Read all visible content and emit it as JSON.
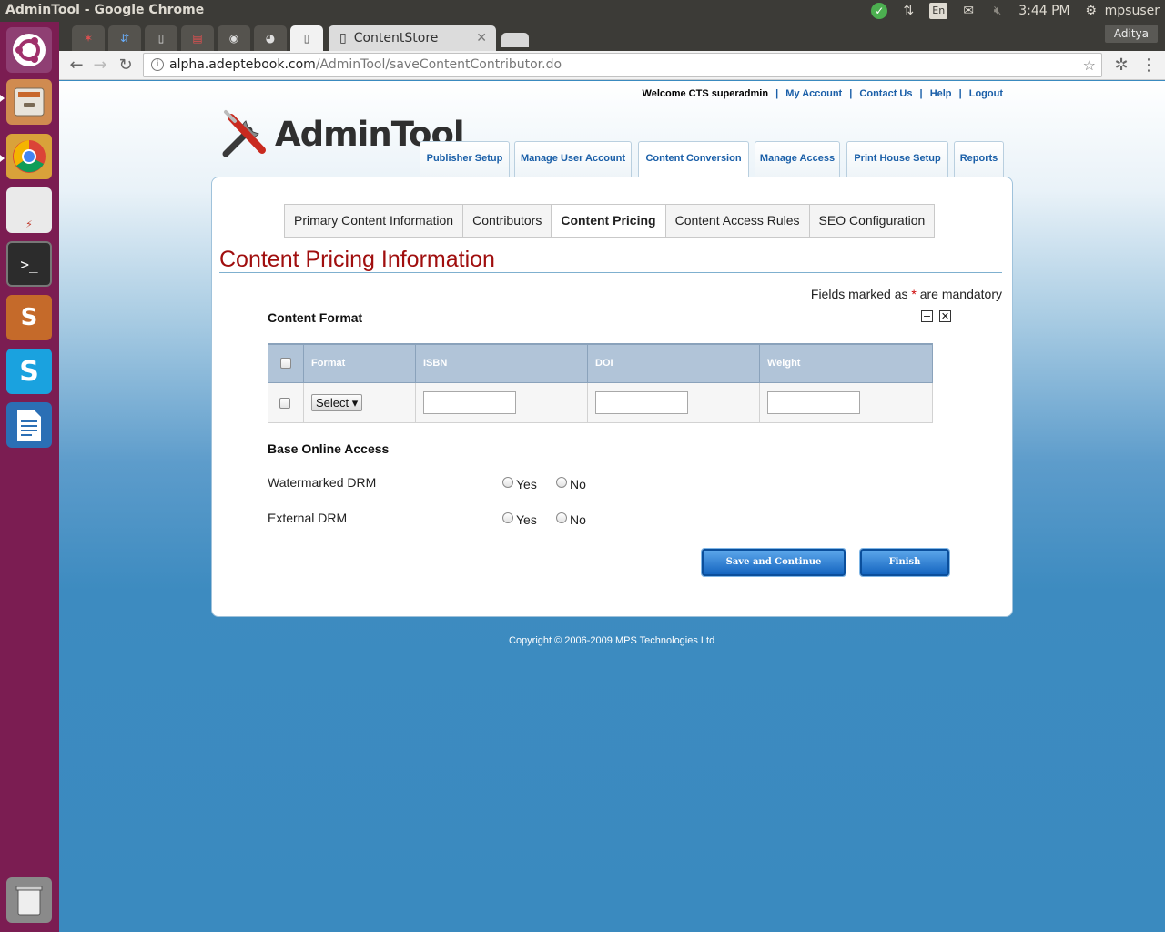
{
  "window": {
    "title": "AdminTool - Google Chrome"
  },
  "tray": {
    "lang": "En",
    "time": "3:44 PM",
    "user": "mpsuser"
  },
  "browser": {
    "active_tab_title": "ContentStore",
    "profile": "Aditya",
    "url_host": "alpha.adeptebook.com",
    "url_path": "/AdminTool/saveContentContributor.do"
  },
  "header": {
    "welcome": "Welcome  CTS superadmin",
    "links": {
      "account": "My Account",
      "contact": "Contact Us",
      "help": "Help",
      "logout": "Logout"
    },
    "logo_text": "AdminTool"
  },
  "main_tabs": [
    "Publisher Setup",
    "Manage User Account",
    "Content Conversion",
    "Manage Access",
    "Print House Setup",
    "Reports"
  ],
  "sub_tabs": [
    "Primary Content Information",
    "Contributors",
    "Content Pricing",
    "Content Access Rules",
    "SEO Configuration"
  ],
  "section_title": "Content Pricing Information",
  "mandatory": {
    "pre": "Fields marked as ",
    "star": "*",
    "post": " are mandatory"
  },
  "content_format": {
    "label": "Content Format",
    "columns": [
      "Format",
      "ISBN",
      "DOI",
      "Weight"
    ],
    "select_value": "Select"
  },
  "base_online_access": {
    "label": "Base Online Access",
    "rows": [
      {
        "label": "Watermarked DRM",
        "yes": "Yes",
        "no": "No"
      },
      {
        "label": "External DRM",
        "yes": "Yes",
        "no": "No"
      }
    ]
  },
  "buttons": {
    "save": "Save and Continue",
    "finish": "Finish"
  },
  "footer": {
    "copyright": "Copyright © 2006-2009 MPS Technologies Ltd"
  }
}
